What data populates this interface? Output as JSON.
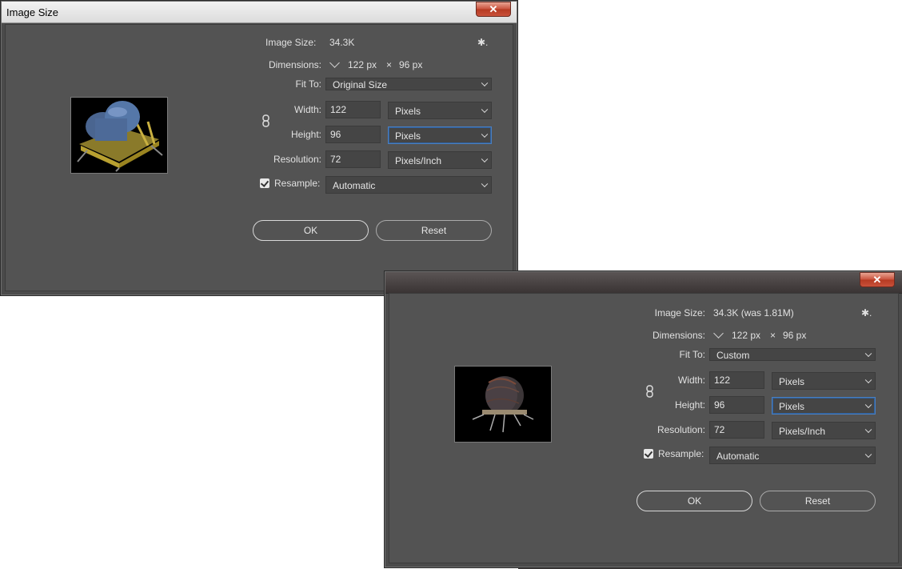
{
  "dialog1": {
    "title": "Image Size",
    "close_symbol": "✕",
    "image_size_label": "Image Size:",
    "image_size_value": "34.3K",
    "dimensions_label": "Dimensions:",
    "dimensions_width": "122 px",
    "dimensions_times": "×",
    "dimensions_height": "96 px",
    "fit_to_label": "Fit To:",
    "fit_to_value": "Original Size",
    "width_label": "Width:",
    "width_value": "122",
    "width_unit": "Pixels",
    "height_label": "Height:",
    "height_value": "96",
    "height_unit": "Pixels",
    "resolution_label": "Resolution:",
    "resolution_value": "72",
    "resolution_unit": "Pixels/Inch",
    "resample_label": "Resample:",
    "resample_value": "Automatic",
    "resample_checked": true,
    "ok_label": "OK",
    "reset_label": "Reset",
    "gear_icon": "gear-icon",
    "preview": "blue-tarp-cargo-on-yellow-sled"
  },
  "dialog2": {
    "close_symbol": "✕",
    "image_size_label": "Image Size:",
    "image_size_value": "34.3K (was 1.81M)",
    "dimensions_label": "Dimensions:",
    "dimensions_width": "122 px",
    "dimensions_times": "×",
    "dimensions_height": "96 px",
    "fit_to_label": "Fit To:",
    "fit_to_value": "Custom",
    "width_label": "Width:",
    "width_value": "122",
    "width_unit": "Pixels",
    "height_label": "Height:",
    "height_value": "96",
    "height_unit": "Pixels",
    "resolution_label": "Resolution:",
    "resolution_value": "72",
    "resolution_unit": "Pixels/Inch",
    "resample_label": "Resample:",
    "resample_value": "Automatic",
    "resample_checked": true,
    "ok_label": "OK",
    "reset_label": "Reset",
    "gear_icon": "gear-icon",
    "preview": "dark-cable-reel-on-frame"
  },
  "colors": {
    "dialog_bg": "#535353",
    "field_bg": "#454545",
    "focus_border": "#4a7fc0",
    "close_button": "#c9513b"
  }
}
